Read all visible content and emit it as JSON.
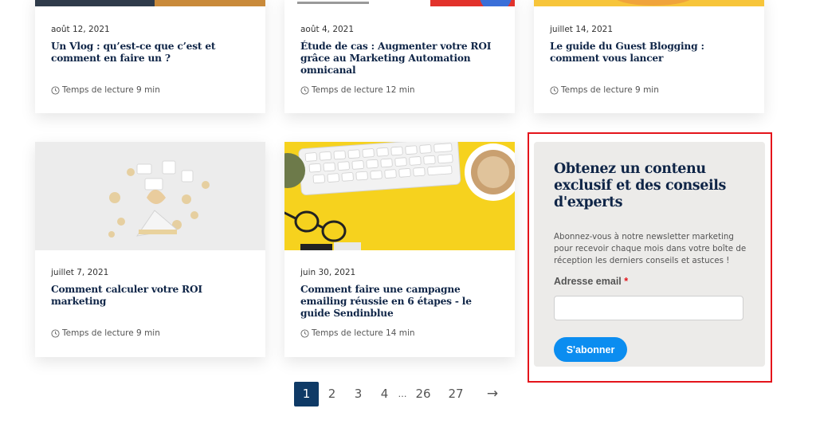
{
  "articles_top": [
    {
      "date": "août 12, 2021",
      "title": "Un Vlog : qu’est-ce que c’est et comment en faire un ?",
      "reading": "Temps de lecture 9 min"
    },
    {
      "date": "août 4, 2021",
      "title": "Étude de cas : Augmenter votre ROI grâce au Marketing Automation omnicanal",
      "reading": "Temps de lecture 12 min"
    },
    {
      "date": "juillet 14, 2021",
      "title": "Le guide du Guest Blogging : comment vous lancer",
      "reading": "Temps de lecture 9 min"
    }
  ],
  "articles_bottom": [
    {
      "date": "juillet 7, 2021",
      "title": "Comment calculer votre ROI marketing",
      "reading": "Temps de lecture 9 min"
    },
    {
      "date": "juin 30, 2021",
      "title": "Comment faire une campagne emailing réussie en 6 étapes - le guide Sendinblue",
      "reading": "Temps de lecture 14 min"
    }
  ],
  "newsletter": {
    "title": "Obtenez un contenu exclusif et des conseils d'experts",
    "description": "Abonnez-vous à notre newsletter marketing pour recevoir chaque mois dans votre boîte de réception les derniers conseils et astuces !",
    "email_label": "Adresse email",
    "required_mark": "*",
    "email_value": "",
    "button_label": "S'abonner"
  },
  "pagination": {
    "current": "1",
    "pages": [
      "2",
      "3",
      "4"
    ],
    "ellipsis": "…",
    "tail_pages": [
      "26",
      "27"
    ],
    "next": "→"
  },
  "colors": {
    "title_navy": "#0f2547",
    "button_blue": "#0b8df0",
    "pagination_active": "#0f3a66",
    "highlight_red": "#e4141b"
  }
}
